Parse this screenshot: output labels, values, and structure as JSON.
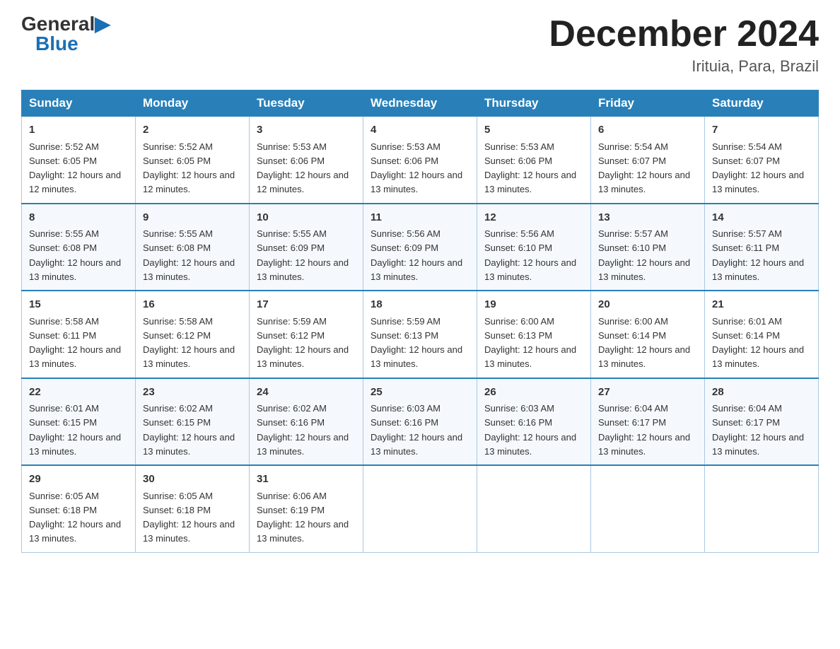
{
  "header": {
    "logo_general": "General",
    "logo_blue": "Blue",
    "month_title": "December 2024",
    "location": "Irituia, Para, Brazil"
  },
  "weekdays": [
    "Sunday",
    "Monday",
    "Tuesday",
    "Wednesday",
    "Thursday",
    "Friday",
    "Saturday"
  ],
  "weeks": [
    [
      {
        "day": "1",
        "sunrise": "5:52 AM",
        "sunset": "6:05 PM",
        "daylight": "12 hours and 12 minutes."
      },
      {
        "day": "2",
        "sunrise": "5:52 AM",
        "sunset": "6:05 PM",
        "daylight": "12 hours and 12 minutes."
      },
      {
        "day": "3",
        "sunrise": "5:53 AM",
        "sunset": "6:06 PM",
        "daylight": "12 hours and 12 minutes."
      },
      {
        "day": "4",
        "sunrise": "5:53 AM",
        "sunset": "6:06 PM",
        "daylight": "12 hours and 13 minutes."
      },
      {
        "day": "5",
        "sunrise": "5:53 AM",
        "sunset": "6:06 PM",
        "daylight": "12 hours and 13 minutes."
      },
      {
        "day": "6",
        "sunrise": "5:54 AM",
        "sunset": "6:07 PM",
        "daylight": "12 hours and 13 minutes."
      },
      {
        "day": "7",
        "sunrise": "5:54 AM",
        "sunset": "6:07 PM",
        "daylight": "12 hours and 13 minutes."
      }
    ],
    [
      {
        "day": "8",
        "sunrise": "5:55 AM",
        "sunset": "6:08 PM",
        "daylight": "12 hours and 13 minutes."
      },
      {
        "day": "9",
        "sunrise": "5:55 AM",
        "sunset": "6:08 PM",
        "daylight": "12 hours and 13 minutes."
      },
      {
        "day": "10",
        "sunrise": "5:55 AM",
        "sunset": "6:09 PM",
        "daylight": "12 hours and 13 minutes."
      },
      {
        "day": "11",
        "sunrise": "5:56 AM",
        "sunset": "6:09 PM",
        "daylight": "12 hours and 13 minutes."
      },
      {
        "day": "12",
        "sunrise": "5:56 AM",
        "sunset": "6:10 PM",
        "daylight": "12 hours and 13 minutes."
      },
      {
        "day": "13",
        "sunrise": "5:57 AM",
        "sunset": "6:10 PM",
        "daylight": "12 hours and 13 minutes."
      },
      {
        "day": "14",
        "sunrise": "5:57 AM",
        "sunset": "6:11 PM",
        "daylight": "12 hours and 13 minutes."
      }
    ],
    [
      {
        "day": "15",
        "sunrise": "5:58 AM",
        "sunset": "6:11 PM",
        "daylight": "12 hours and 13 minutes."
      },
      {
        "day": "16",
        "sunrise": "5:58 AM",
        "sunset": "6:12 PM",
        "daylight": "12 hours and 13 minutes."
      },
      {
        "day": "17",
        "sunrise": "5:59 AM",
        "sunset": "6:12 PM",
        "daylight": "12 hours and 13 minutes."
      },
      {
        "day": "18",
        "sunrise": "5:59 AM",
        "sunset": "6:13 PM",
        "daylight": "12 hours and 13 minutes."
      },
      {
        "day": "19",
        "sunrise": "6:00 AM",
        "sunset": "6:13 PM",
        "daylight": "12 hours and 13 minutes."
      },
      {
        "day": "20",
        "sunrise": "6:00 AM",
        "sunset": "6:14 PM",
        "daylight": "12 hours and 13 minutes."
      },
      {
        "day": "21",
        "sunrise": "6:01 AM",
        "sunset": "6:14 PM",
        "daylight": "12 hours and 13 minutes."
      }
    ],
    [
      {
        "day": "22",
        "sunrise": "6:01 AM",
        "sunset": "6:15 PM",
        "daylight": "12 hours and 13 minutes."
      },
      {
        "day": "23",
        "sunrise": "6:02 AM",
        "sunset": "6:15 PM",
        "daylight": "12 hours and 13 minutes."
      },
      {
        "day": "24",
        "sunrise": "6:02 AM",
        "sunset": "6:16 PM",
        "daylight": "12 hours and 13 minutes."
      },
      {
        "day": "25",
        "sunrise": "6:03 AM",
        "sunset": "6:16 PM",
        "daylight": "12 hours and 13 minutes."
      },
      {
        "day": "26",
        "sunrise": "6:03 AM",
        "sunset": "6:16 PM",
        "daylight": "12 hours and 13 minutes."
      },
      {
        "day": "27",
        "sunrise": "6:04 AM",
        "sunset": "6:17 PM",
        "daylight": "12 hours and 13 minutes."
      },
      {
        "day": "28",
        "sunrise": "6:04 AM",
        "sunset": "6:17 PM",
        "daylight": "12 hours and 13 minutes."
      }
    ],
    [
      {
        "day": "29",
        "sunrise": "6:05 AM",
        "sunset": "6:18 PM",
        "daylight": "12 hours and 13 minutes."
      },
      {
        "day": "30",
        "sunrise": "6:05 AM",
        "sunset": "6:18 PM",
        "daylight": "12 hours and 13 minutes."
      },
      {
        "day": "31",
        "sunrise": "6:06 AM",
        "sunset": "6:19 PM",
        "daylight": "12 hours and 13 minutes."
      },
      null,
      null,
      null,
      null
    ]
  ]
}
